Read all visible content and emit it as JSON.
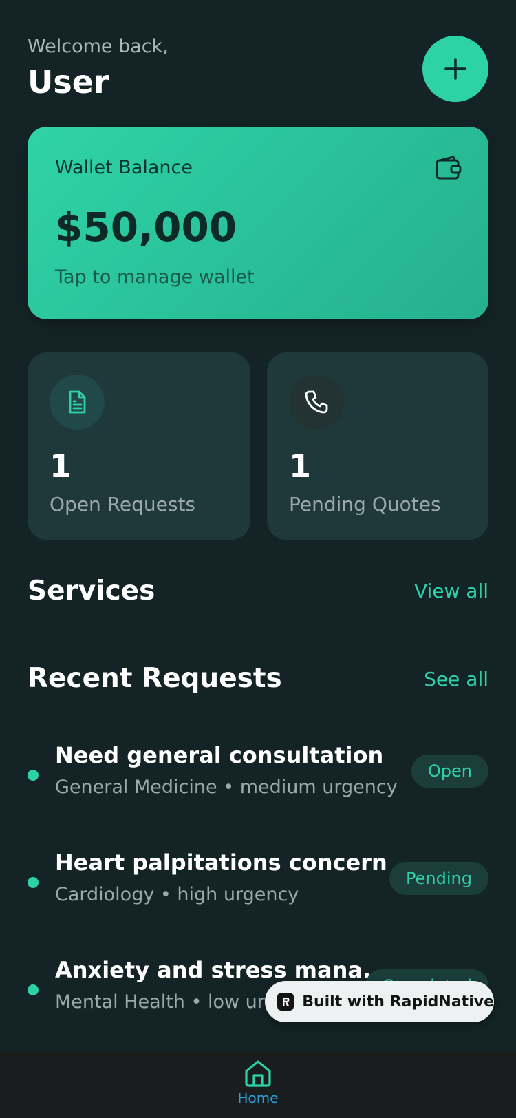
{
  "header": {
    "greeting": "Welcome back,",
    "username": "User",
    "add_icon": "plus-icon"
  },
  "wallet": {
    "label": "Wallet Balance",
    "amount": "$50,000",
    "hint": "Tap to manage wallet",
    "icon": "wallet-icon"
  },
  "stats": [
    {
      "value": "1",
      "label": "Open Requests",
      "icon": "document-icon"
    },
    {
      "value": "1",
      "label": "Pending Quotes",
      "icon": "phone-icon"
    }
  ],
  "services": {
    "title": "Services",
    "link": "View all"
  },
  "recent_requests": {
    "title": "Recent Requests",
    "link": "See all",
    "items": [
      {
        "title": "Need general consultation",
        "subtitle": "General Medicine • medium urgency",
        "status": "Open"
      },
      {
        "title": "Heart palpitations concern",
        "subtitle": "Cardiology • high urgency",
        "status": "Pending"
      },
      {
        "title": "Anxiety and stress mana...",
        "subtitle": "Mental Health • low urg",
        "status": "Completed"
      }
    ]
  },
  "built_with": {
    "text": "Built with RapidNative"
  },
  "tab_bar": {
    "items": [
      {
        "label": "Home",
        "icon": "home-icon"
      }
    ]
  },
  "colors": {
    "background": "#142426",
    "accent": "#2dd3a5",
    "card": "#1f3839",
    "tab_active": "#2d9fd6"
  }
}
